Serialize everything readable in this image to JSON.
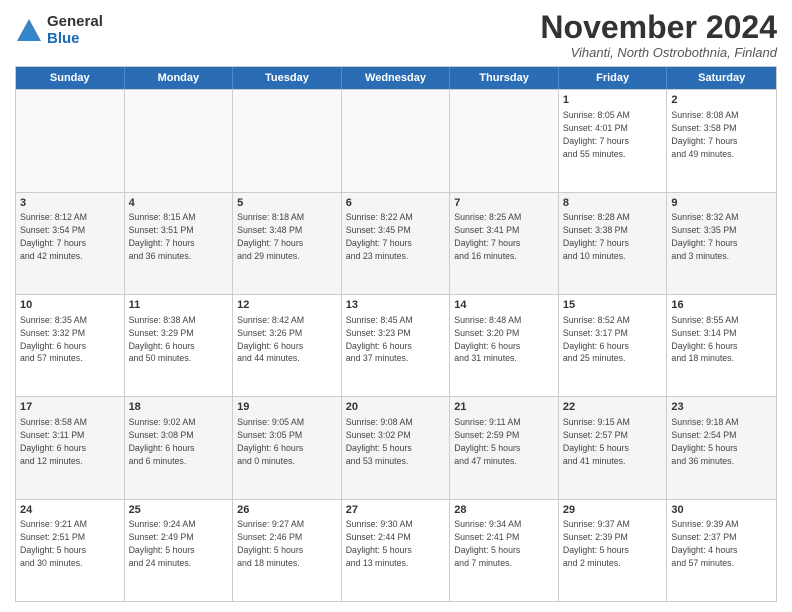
{
  "logo": {
    "general": "General",
    "blue": "Blue"
  },
  "title": "November 2024",
  "location": "Vihanti, North Ostrobothnia, Finland",
  "header_days": [
    "Sunday",
    "Monday",
    "Tuesday",
    "Wednesday",
    "Thursday",
    "Friday",
    "Saturday"
  ],
  "weeks": [
    [
      {
        "day": "",
        "info": "",
        "empty": true
      },
      {
        "day": "",
        "info": "",
        "empty": true
      },
      {
        "day": "",
        "info": "",
        "empty": true
      },
      {
        "day": "",
        "info": "",
        "empty": true
      },
      {
        "day": "",
        "info": "",
        "empty": true
      },
      {
        "day": "1",
        "info": "Sunrise: 8:05 AM\nSunset: 4:01 PM\nDaylight: 7 hours\nand 55 minutes.",
        "empty": false
      },
      {
        "day": "2",
        "info": "Sunrise: 8:08 AM\nSunset: 3:58 PM\nDaylight: 7 hours\nand 49 minutes.",
        "empty": false
      }
    ],
    [
      {
        "day": "3",
        "info": "Sunrise: 8:12 AM\nSunset: 3:54 PM\nDaylight: 7 hours\nand 42 minutes.",
        "empty": false
      },
      {
        "day": "4",
        "info": "Sunrise: 8:15 AM\nSunset: 3:51 PM\nDaylight: 7 hours\nand 36 minutes.",
        "empty": false
      },
      {
        "day": "5",
        "info": "Sunrise: 8:18 AM\nSunset: 3:48 PM\nDaylight: 7 hours\nand 29 minutes.",
        "empty": false
      },
      {
        "day": "6",
        "info": "Sunrise: 8:22 AM\nSunset: 3:45 PM\nDaylight: 7 hours\nand 23 minutes.",
        "empty": false
      },
      {
        "day": "7",
        "info": "Sunrise: 8:25 AM\nSunset: 3:41 PM\nDaylight: 7 hours\nand 16 minutes.",
        "empty": false
      },
      {
        "day": "8",
        "info": "Sunrise: 8:28 AM\nSunset: 3:38 PM\nDaylight: 7 hours\nand 10 minutes.",
        "empty": false
      },
      {
        "day": "9",
        "info": "Sunrise: 8:32 AM\nSunset: 3:35 PM\nDaylight: 7 hours\nand 3 minutes.",
        "empty": false
      }
    ],
    [
      {
        "day": "10",
        "info": "Sunrise: 8:35 AM\nSunset: 3:32 PM\nDaylight: 6 hours\nand 57 minutes.",
        "empty": false
      },
      {
        "day": "11",
        "info": "Sunrise: 8:38 AM\nSunset: 3:29 PM\nDaylight: 6 hours\nand 50 minutes.",
        "empty": false
      },
      {
        "day": "12",
        "info": "Sunrise: 8:42 AM\nSunset: 3:26 PM\nDaylight: 6 hours\nand 44 minutes.",
        "empty": false
      },
      {
        "day": "13",
        "info": "Sunrise: 8:45 AM\nSunset: 3:23 PM\nDaylight: 6 hours\nand 37 minutes.",
        "empty": false
      },
      {
        "day": "14",
        "info": "Sunrise: 8:48 AM\nSunset: 3:20 PM\nDaylight: 6 hours\nand 31 minutes.",
        "empty": false
      },
      {
        "day": "15",
        "info": "Sunrise: 8:52 AM\nSunset: 3:17 PM\nDaylight: 6 hours\nand 25 minutes.",
        "empty": false
      },
      {
        "day": "16",
        "info": "Sunrise: 8:55 AM\nSunset: 3:14 PM\nDaylight: 6 hours\nand 18 minutes.",
        "empty": false
      }
    ],
    [
      {
        "day": "17",
        "info": "Sunrise: 8:58 AM\nSunset: 3:11 PM\nDaylight: 6 hours\nand 12 minutes.",
        "empty": false
      },
      {
        "day": "18",
        "info": "Sunrise: 9:02 AM\nSunset: 3:08 PM\nDaylight: 6 hours\nand 6 minutes.",
        "empty": false
      },
      {
        "day": "19",
        "info": "Sunrise: 9:05 AM\nSunset: 3:05 PM\nDaylight: 6 hours\nand 0 minutes.",
        "empty": false
      },
      {
        "day": "20",
        "info": "Sunrise: 9:08 AM\nSunset: 3:02 PM\nDaylight: 5 hours\nand 53 minutes.",
        "empty": false
      },
      {
        "day": "21",
        "info": "Sunrise: 9:11 AM\nSunset: 2:59 PM\nDaylight: 5 hours\nand 47 minutes.",
        "empty": false
      },
      {
        "day": "22",
        "info": "Sunrise: 9:15 AM\nSunset: 2:57 PM\nDaylight: 5 hours\nand 41 minutes.",
        "empty": false
      },
      {
        "day": "23",
        "info": "Sunrise: 9:18 AM\nSunset: 2:54 PM\nDaylight: 5 hours\nand 36 minutes.",
        "empty": false
      }
    ],
    [
      {
        "day": "24",
        "info": "Sunrise: 9:21 AM\nSunset: 2:51 PM\nDaylight: 5 hours\nand 30 minutes.",
        "empty": false
      },
      {
        "day": "25",
        "info": "Sunrise: 9:24 AM\nSunset: 2:49 PM\nDaylight: 5 hours\nand 24 minutes.",
        "empty": false
      },
      {
        "day": "26",
        "info": "Sunrise: 9:27 AM\nSunset: 2:46 PM\nDaylight: 5 hours\nand 18 minutes.",
        "empty": false
      },
      {
        "day": "27",
        "info": "Sunrise: 9:30 AM\nSunset: 2:44 PM\nDaylight: 5 hours\nand 13 minutes.",
        "empty": false
      },
      {
        "day": "28",
        "info": "Sunrise: 9:34 AM\nSunset: 2:41 PM\nDaylight: 5 hours\nand 7 minutes.",
        "empty": false
      },
      {
        "day": "29",
        "info": "Sunrise: 9:37 AM\nSunset: 2:39 PM\nDaylight: 5 hours\nand 2 minutes.",
        "empty": false
      },
      {
        "day": "30",
        "info": "Sunrise: 9:39 AM\nSunset: 2:37 PM\nDaylight: 4 hours\nand 57 minutes.",
        "empty": false
      }
    ]
  ]
}
